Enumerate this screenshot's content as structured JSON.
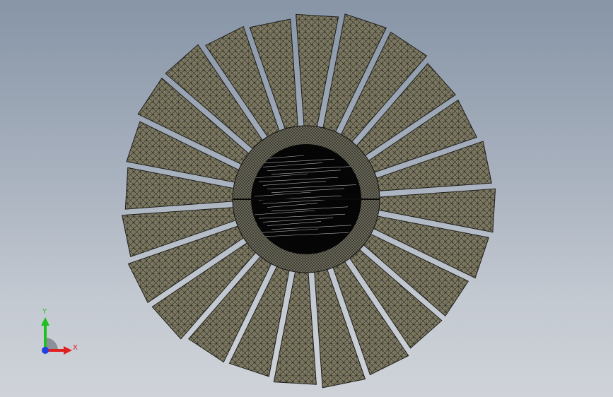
{
  "viewport": {
    "model": {
      "blade_count": 24,
      "mesh_fill": "#7f7b63",
      "mesh_line": "#1f1f1c",
      "hub_fill": "#6b695a",
      "bore_fill": "#050505"
    },
    "triad": {
      "y_label": "Y",
      "x_label": "X",
      "y_color": "#1fbf1f",
      "x_color": "#e02020",
      "z_color": "#1f3fe0",
      "plane_color": "#8a8f99"
    }
  }
}
